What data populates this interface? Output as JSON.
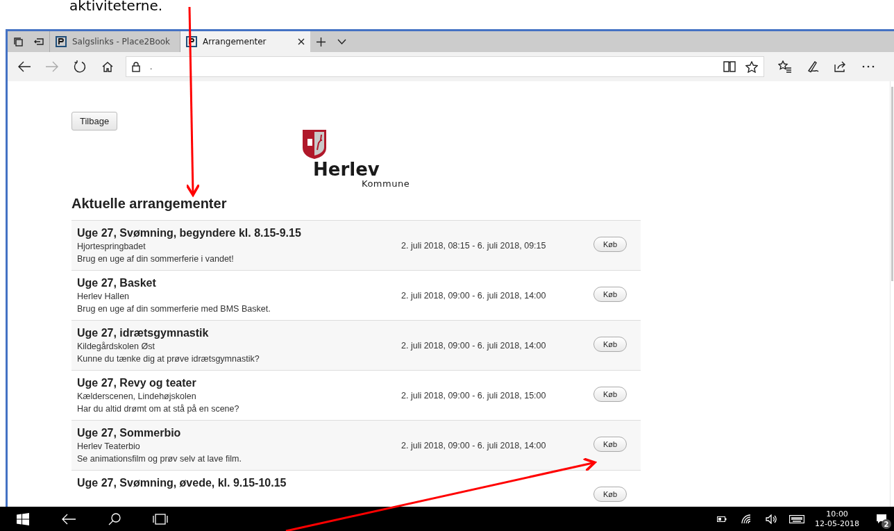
{
  "annotation": {
    "text": "aktiviteterne."
  },
  "browser": {
    "tabs": [
      {
        "label": "Salgslinks - Place2Book",
        "selected": false
      },
      {
        "label": "Arrangementer",
        "selected": true
      }
    ],
    "address": "."
  },
  "page": {
    "back_button": "Tilbage",
    "logo": {
      "name": "Herlev",
      "sub": "Kommune"
    },
    "heading": "Aktuelle arrangementer",
    "events": [
      {
        "title": "Uge 27, Svømning, begyndere kl. 8.15-9.15",
        "venue": "Hjortespringbadet",
        "description": "Brug en uge af din sommerferie i vandet!",
        "dates": "2. juli 2018, 08:15 - 6. juli 2018, 09:15",
        "button": "Køb"
      },
      {
        "title": "Uge 27, Basket",
        "venue": "Herlev Hallen",
        "description": "Brug en uge af din sommerferie med BMS Basket.",
        "dates": "2. juli 2018, 09:00 - 6. juli 2018, 14:00",
        "button": "Køb"
      },
      {
        "title": "Uge 27, idrætsgymnastik",
        "venue": "Kildegårdskolen Øst",
        "description": "Kunne du tænke dig at prøve idrætsgymnastik?",
        "dates": "2. juli 2018, 09:00 - 6. juli 2018, 14:00",
        "button": "Køb"
      },
      {
        "title": "Uge 27, Revy og teater",
        "venue": "Kælderscenen, Lindehøjskolen",
        "description": "Har du altid drømt om at stå på en scene?",
        "dates": "2. juli 2018, 09:00 - 6. juli 2018, 15:00",
        "button": "Køb"
      },
      {
        "title": "Uge 27, Sommerbio",
        "venue": "Herlev Teaterbio",
        "description": "Se animationsfilm og prøv selv at lave film.",
        "dates": "2. juli 2018, 09:00 - 6. juli 2018, 14:00",
        "button": "Køb"
      },
      {
        "title": "Uge 27, Svømning, øvede, kl. 9.15-10.15",
        "button": "Køb"
      }
    ]
  },
  "taskbar": {
    "time": "10:00",
    "date": "12-05-2018",
    "notifications": "2"
  }
}
